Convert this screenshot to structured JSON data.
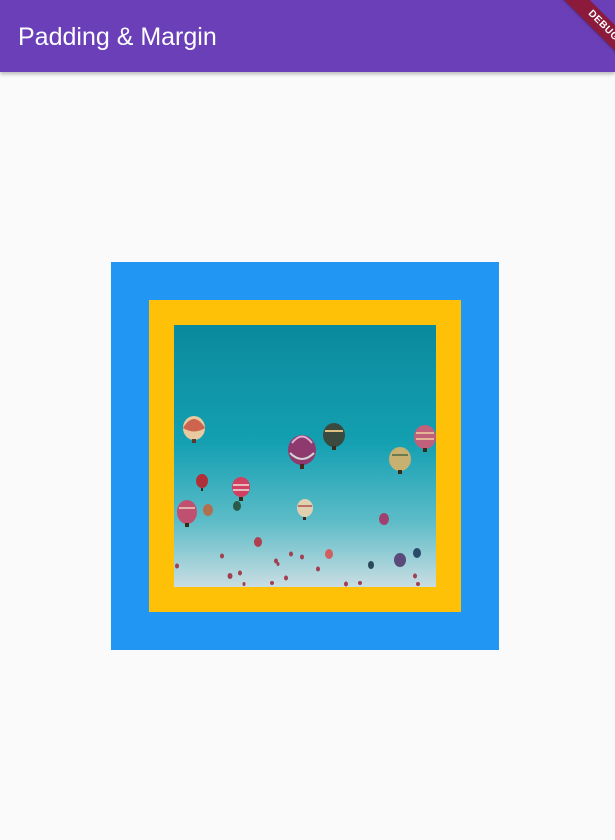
{
  "app_bar": {
    "title": "Padding & Margin",
    "color": "#6a3fb8"
  },
  "debug_banner": {
    "label": "DEBUG",
    "color": "#8b1a3b"
  },
  "containers": {
    "outer_color": "#2196f3",
    "inner_color": "#ffc107"
  },
  "image": {
    "subject": "hot-air-balloons-in-sky"
  }
}
